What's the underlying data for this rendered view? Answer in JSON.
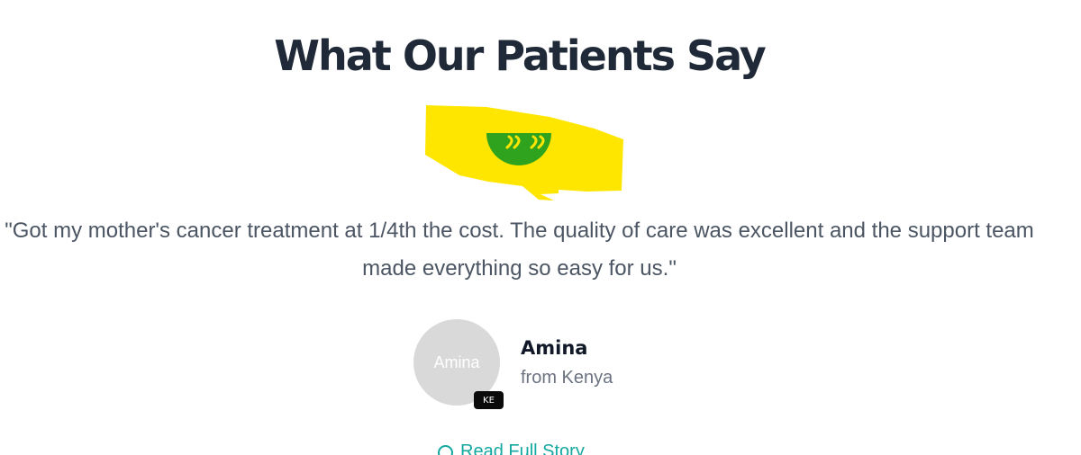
{
  "section": {
    "title": "What Our Patients Say"
  },
  "testimonial": {
    "quote_icon": "quote-icon",
    "quote": "\"Got my mother's cancer treatment at 1/4th the cost. The quality of care was excellent and the support team made everything so easy for us.\"",
    "avatar_text": "Amina",
    "country_code": "KE",
    "name": "Amina",
    "origin": "from Kenya",
    "read_more_label": "Read Full Story"
  },
  "colors": {
    "heading": "#1f2937",
    "quote_text": "#4b5563",
    "icon_green": "#2fa31e",
    "highlight_yellow": "#ffe600",
    "link_teal": "#14a8a0",
    "avatar_bg": "#d9d9d9"
  }
}
